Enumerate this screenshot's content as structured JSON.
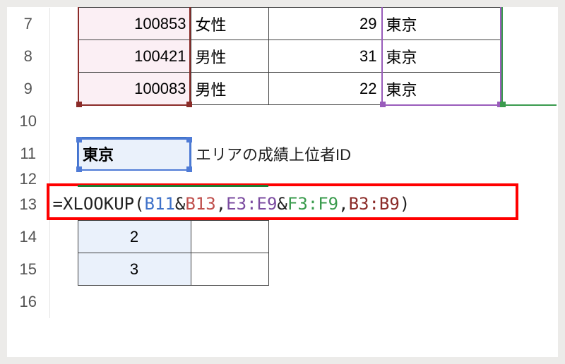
{
  "rows": {
    "header": [
      "7",
      "8",
      "9",
      "10",
      "11",
      "12",
      "13",
      "14",
      "15",
      "16"
    ]
  },
  "table": {
    "r7": {
      "B": "100853",
      "C": "女性",
      "D": "29",
      "E": "東京"
    },
    "r8": {
      "B": "100421",
      "C": "男性",
      "D": "31",
      "E": "東京"
    },
    "r9": {
      "B": "100083",
      "C": "男性",
      "D": "22",
      "E": "東京"
    }
  },
  "row11": {
    "B": "東京",
    "label": "エリアの成績上位者ID"
  },
  "formula": {
    "prefix": "=XLOOKUP(",
    "a1": "B11",
    "amp1": "&",
    "a2": "B13",
    "comma1": ",",
    "a3": "E3:E9",
    "amp2": "&",
    "a4": "F3:F9",
    "comma2": ",",
    "a5": "B3:B9",
    "suffix": ")"
  },
  "row14": {
    "B": "2"
  },
  "row15": {
    "B": "3"
  }
}
